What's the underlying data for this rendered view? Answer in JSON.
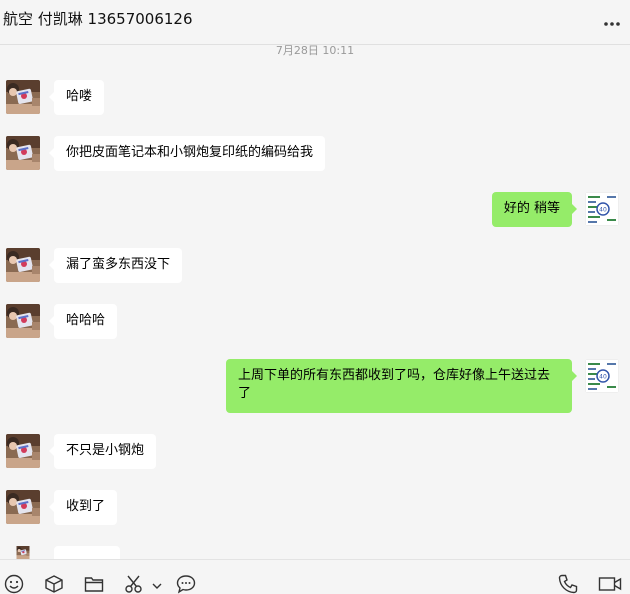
{
  "header": {
    "title": "航空 付凯琳 13657006126",
    "menu_icon": "more-horizontal-icon"
  },
  "chat": {
    "timestamp": "7月28日 10:11",
    "messages": [
      {
        "side": "left",
        "text": "哈喽"
      },
      {
        "side": "left",
        "text": "你把皮面笔记本和小钢炮复印纸的编码给我"
      },
      {
        "side": "right",
        "text": "好的 稍等"
      },
      {
        "side": "left",
        "text": "漏了蛮多东西没下"
      },
      {
        "side": "left",
        "text": "哈哈哈"
      },
      {
        "side": "right",
        "text": "上周下单的所有东西都收到了吗，仓库好像上午送过去了"
      },
      {
        "side": "left",
        "text": "不只是小钢炮"
      },
      {
        "side": "left",
        "text": "收到了"
      }
    ]
  },
  "toolbar": {
    "icons": [
      "emoji-icon",
      "box-icon",
      "folder-icon",
      "scissors-icon",
      "chevron-down-icon",
      "chat-bubble-icon",
      "phone-icon",
      "video-call-icon"
    ]
  },
  "colors": {
    "background": "#f5f5f5",
    "own_bubble": "#95ec69",
    "other_bubble": "#ffffff",
    "timestamp_text": "#999999"
  }
}
